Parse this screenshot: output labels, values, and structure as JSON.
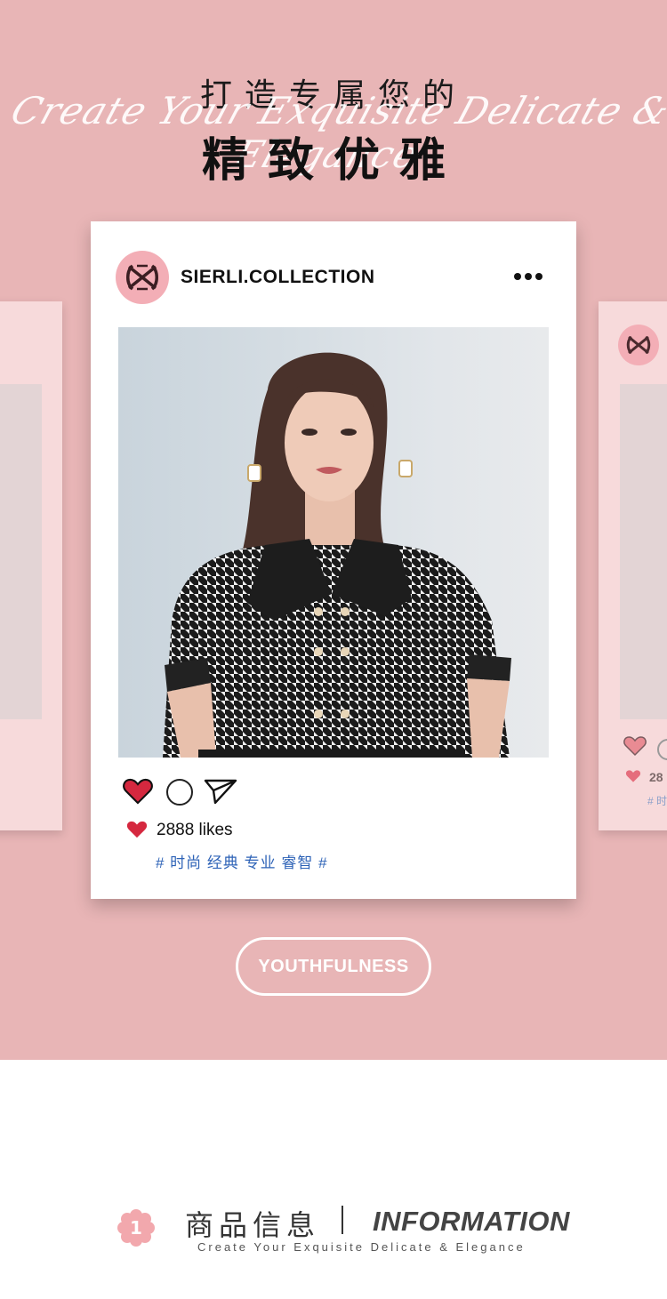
{
  "header": {
    "title_line1": "打造专属您的",
    "script_line": "Create Your Exquisite Delicate & Elegance",
    "title_line2": "精致优雅"
  },
  "post": {
    "account_name": "SIERLI.COLLECTION",
    "more_icon": "more-dots-icon",
    "likes_text": "2888 likes",
    "hashtags": "# 时尚 经典 专业 睿智 #",
    "photo_alt": "model wearing houndstooth blouse with leather collar"
  },
  "side_card_right": {
    "likes_text": "28",
    "hashtag": "# 时"
  },
  "cta": {
    "label": "YOUTHFULNESS"
  },
  "info_section": {
    "badge_number": "1",
    "title_cn": "商品信息",
    "title_en": "INFORMATION",
    "subtitle": "Create Your Exquisite Delicate & Elegance"
  },
  "colors": {
    "background_pink": "#e8b5b6",
    "side_card_pink": "#f7dadb",
    "logo_pink": "#f3aeb6",
    "heart_red": "#d5283f",
    "hashtag_blue": "#2e63b7"
  }
}
